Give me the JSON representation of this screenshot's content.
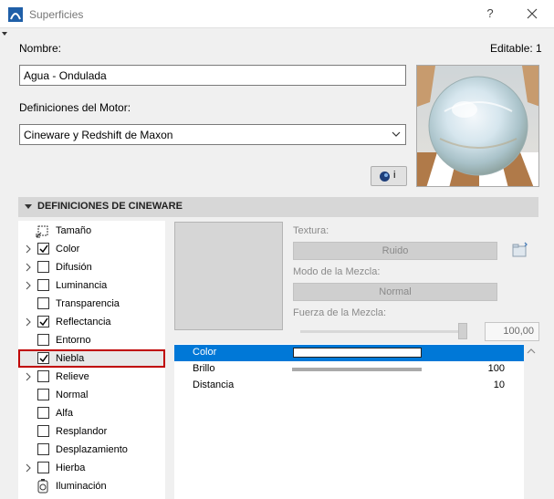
{
  "window": {
    "title": "Superficies",
    "help": "?"
  },
  "header": {
    "name_label": "Nombre:",
    "editable_label": "Editable: 1",
    "name_value": "Agua - Ondulada",
    "engine_label": "Definiciones del Motor:",
    "engine_value": "Cineware y Redshift de Maxon",
    "info_button_label": "i"
  },
  "section": {
    "title": "DEFINICIONES DE CINEWARE"
  },
  "channels": [
    {
      "label": "Tamaño",
      "icon": "size-icon",
      "expandable": false,
      "checked": null
    },
    {
      "label": "Color",
      "expandable": true,
      "checked": true
    },
    {
      "label": "Difusión",
      "expandable": true,
      "checked": false
    },
    {
      "label": "Luminancia",
      "expandable": true,
      "checked": false
    },
    {
      "label": "Transparencia",
      "expandable": false,
      "checked": false
    },
    {
      "label": "Reflectancia",
      "expandable": true,
      "checked": true
    },
    {
      "label": "Entorno",
      "expandable": false,
      "checked": false
    },
    {
      "label": "Niebla",
      "expandable": false,
      "checked": true,
      "selected": true
    },
    {
      "label": "Relieve",
      "expandable": true,
      "checked": false
    },
    {
      "label": "Normal",
      "expandable": false,
      "checked": false
    },
    {
      "label": "Alfa",
      "expandable": false,
      "checked": false
    },
    {
      "label": "Resplandor",
      "expandable": false,
      "checked": false
    },
    {
      "label": "Desplazamiento",
      "expandable": false,
      "checked": false
    },
    {
      "label": "Hierba",
      "expandable": true,
      "checked": false
    },
    {
      "label": "Iluminación",
      "icon": "lighting-icon",
      "expandable": false,
      "checked": null
    }
  ],
  "texture": {
    "texture_label": "Textura:",
    "texture_value": "Ruido",
    "blend_mode_label": "Modo de la Mezcla:",
    "blend_mode_value": "Normal",
    "blend_strength_label": "Fuerza de la Mezcla:",
    "blend_strength_value": "100,00",
    "blend_strength_fraction": 1.0
  },
  "params": [
    {
      "name": "Color",
      "type": "color",
      "color": "#ffffff",
      "selected": true
    },
    {
      "name": "Brillo",
      "type": "bar",
      "value": "100"
    },
    {
      "name": "Distancia",
      "type": "number",
      "value": "10"
    }
  ],
  "colors": {
    "selection": "#0078d7",
    "highlight_outline": "#c00000",
    "section_bg": "#d7d7d7"
  }
}
